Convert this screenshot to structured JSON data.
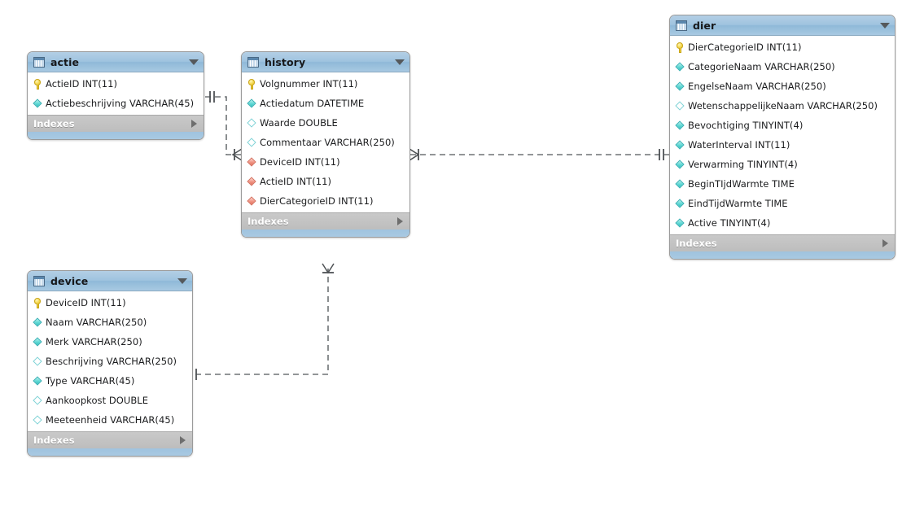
{
  "app": {
    "kind": "er-diagram",
    "background": "#ffffff",
    "header_color": "#9fc3df",
    "indexes_bar_color": "#c2c2c2",
    "pk_icon_color": "#edcd3d",
    "notnull_icon_color": "#5fd8d4",
    "fk_icon_color": "#f09383",
    "connector_color": "#6e7275"
  },
  "tables": [
    {
      "id": "actie",
      "name": "actie",
      "icon": "table-icon",
      "collapse_icon": "chevron-down-icon",
      "indexes_label": "Indexes",
      "indexes_expand_icon": "chevron-right-icon",
      "columns": [
        {
          "label": "ActieID INT(11)",
          "icon": "key-icon",
          "kind": "pk"
        },
        {
          "label": "Actiebeschrijving VARCHAR(45)",
          "icon": "diamond-icon",
          "kind": "notnull"
        }
      ]
    },
    {
      "id": "history",
      "name": "history",
      "icon": "table-icon",
      "collapse_icon": "chevron-down-icon",
      "indexes_label": "Indexes",
      "indexes_expand_icon": "chevron-right-icon",
      "columns": [
        {
          "label": "Volgnummer INT(11)",
          "icon": "key-icon",
          "kind": "pk"
        },
        {
          "label": "Actiedatum DATETIME",
          "icon": "diamond-icon",
          "kind": "notnull"
        },
        {
          "label": "Waarde DOUBLE",
          "icon": "diamond-icon",
          "kind": "nullable"
        },
        {
          "label": "Commentaar VARCHAR(250)",
          "icon": "diamond-icon",
          "kind": "nullable"
        },
        {
          "label": "DeviceID INT(11)",
          "icon": "diamond-icon",
          "kind": "fk"
        },
        {
          "label": "ActieID INT(11)",
          "icon": "diamond-icon",
          "kind": "fk"
        },
        {
          "label": "DierCategorieID INT(11)",
          "icon": "diamond-icon",
          "kind": "fk"
        }
      ]
    },
    {
      "id": "dier",
      "name": "dier",
      "icon": "table-icon",
      "collapse_icon": "chevron-down-icon",
      "indexes_label": "Indexes",
      "indexes_expand_icon": "chevron-right-icon",
      "columns": [
        {
          "label": "DierCategorieID INT(11)",
          "icon": "key-icon",
          "kind": "pk"
        },
        {
          "label": "CategorieNaam VARCHAR(250)",
          "icon": "diamond-icon",
          "kind": "notnull"
        },
        {
          "label": "EngelseNaam VARCHAR(250)",
          "icon": "diamond-icon",
          "kind": "notnull"
        },
        {
          "label": "WetenschappelijkeNaam VARCHAR(250)",
          "icon": "diamond-icon",
          "kind": "nullable"
        },
        {
          "label": "Bevochtiging TINYINT(4)",
          "icon": "diamond-icon",
          "kind": "notnull"
        },
        {
          "label": "WaterInterval INT(11)",
          "icon": "diamond-icon",
          "kind": "notnull"
        },
        {
          "label": "Verwarming TINYINT(4)",
          "icon": "diamond-icon",
          "kind": "notnull"
        },
        {
          "label": "BeginTIjdWarmte TIME",
          "icon": "diamond-icon",
          "kind": "notnull"
        },
        {
          "label": "EindTijdWarmte TIME",
          "icon": "diamond-icon",
          "kind": "notnull"
        },
        {
          "label": "Active TINYINT(4)",
          "icon": "diamond-icon",
          "kind": "notnull"
        }
      ]
    },
    {
      "id": "device",
      "name": "device",
      "icon": "table-icon",
      "collapse_icon": "chevron-down-icon",
      "indexes_label": "Indexes",
      "indexes_expand_icon": "chevron-right-icon",
      "columns": [
        {
          "label": "DeviceID INT(11)",
          "icon": "key-icon",
          "kind": "pk"
        },
        {
          "label": "Naam VARCHAR(250)",
          "icon": "diamond-icon",
          "kind": "notnull"
        },
        {
          "label": "Merk VARCHAR(250)",
          "icon": "diamond-icon",
          "kind": "notnull"
        },
        {
          "label": "Beschrijving VARCHAR(250)",
          "icon": "diamond-icon",
          "kind": "nullable"
        },
        {
          "label": "Type VARCHAR(45)",
          "icon": "diamond-icon",
          "kind": "notnull"
        },
        {
          "label": "Aankoopkost DOUBLE",
          "icon": "diamond-icon",
          "kind": "nullable"
        },
        {
          "label": "Meeteenheid VARCHAR(45)",
          "icon": "diamond-icon",
          "kind": "nullable"
        }
      ]
    }
  ],
  "relationships": [
    {
      "id": "actie-history",
      "from": "actie",
      "to": "history",
      "from_cardinality": "one",
      "to_cardinality": "many",
      "style": "dashed"
    },
    {
      "id": "history-dier",
      "from": "history",
      "to": "dier",
      "from_cardinality": "many",
      "to_cardinality": "one",
      "style": "dashed"
    },
    {
      "id": "device-history",
      "from": "device",
      "to": "history",
      "from_cardinality": "one",
      "to_cardinality": "many",
      "style": "dashed"
    }
  ]
}
